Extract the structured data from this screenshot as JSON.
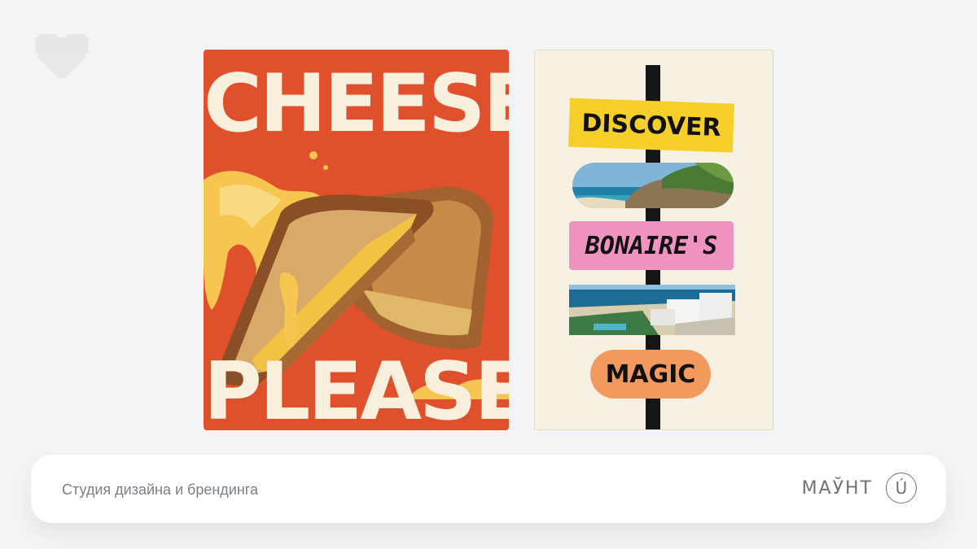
{
  "colors": {
    "page_bg": "#f3f4f6",
    "cheese_bg": "#e0502c",
    "cheese_text": "#f8f0dc",
    "discover": "#f7cf2a",
    "bonaire": "#ef93c1",
    "magic": "#f29a5e",
    "pole": "#151515"
  },
  "icons": {
    "heart": "pixel-heart-icon",
    "brand_mark": "circle-u-logo"
  },
  "poster_cheese": {
    "line1": "CHEESE",
    "line2": "PLEASE"
  },
  "poster_bonaire": {
    "sign1": "DISCOVER",
    "sign2": "BONAIRE'S",
    "sign3": "MAGIC"
  },
  "footer": {
    "tagline": "Студия дизайна и брендинга",
    "brand": "МАЎНТ",
    "brand_mark": "Ú"
  }
}
